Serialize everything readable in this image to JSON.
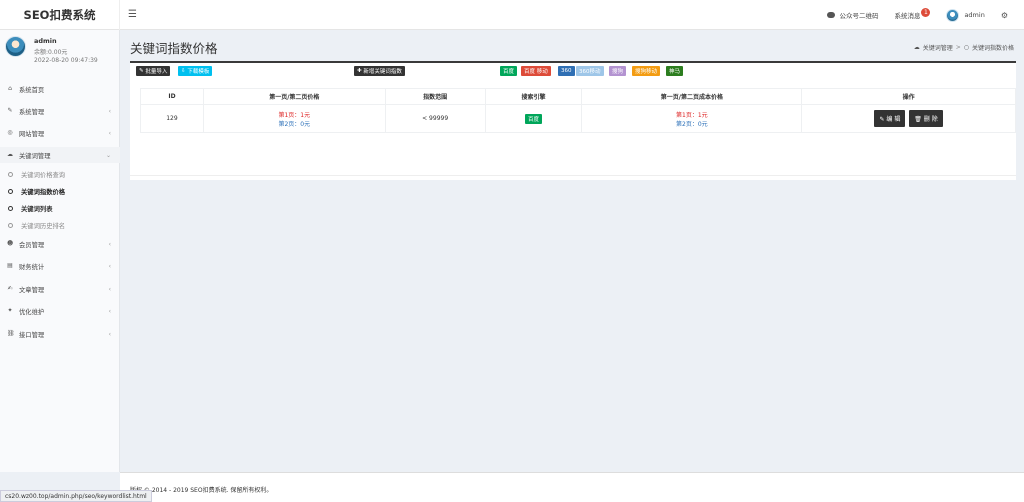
{
  "app": {
    "logo": "SEO扣费系统"
  },
  "topbar": {
    "menu_icon": "☰",
    "qrcode_label": "公众号二维码",
    "messages_label": "系统消息",
    "messages_count": "1",
    "user_name": "admin"
  },
  "user": {
    "name": "admin",
    "balance": "余额:0.00元",
    "login_time": "2022-08-20 09:47:39"
  },
  "sidebar": {
    "items": [
      {
        "label": "系统首页",
        "icon": "home-icon"
      },
      {
        "label": "系统管理",
        "icon": "wrench-icon"
      },
      {
        "label": "网站管理",
        "icon": "globe-icon"
      },
      {
        "label": "关键词管理",
        "icon": "cloud-icon"
      },
      {
        "label": "会员管理",
        "icon": "users-icon"
      },
      {
        "label": "财务统计",
        "icon": "money-icon"
      },
      {
        "label": "文章管理",
        "icon": "edit-icon"
      },
      {
        "label": "优化维护",
        "icon": "tools-icon"
      },
      {
        "label": "接口管理",
        "icon": "link-icon"
      }
    ],
    "sub_items": [
      {
        "label": "关键词价格查询"
      },
      {
        "label": "关键词指数价格"
      },
      {
        "label": "关键词列表"
      },
      {
        "label": "关键词历史排名"
      }
    ]
  },
  "page": {
    "title": "关键词指数价格",
    "breadcrumb": [
      "关键词管理",
      "关键词指数价格"
    ]
  },
  "toolbar": {
    "import_label": "批量导入",
    "download_label": "下载模板",
    "add_label": "新增关键词指数",
    "engines": [
      "百度",
      "百度 移动",
      "360",
      "360移动",
      "搜狗",
      "搜狗移动",
      "神马"
    ]
  },
  "table": {
    "headers": [
      "ID",
      "第一页/第二页价格",
      "指数范围",
      "搜索引擎",
      "第一页/第二页成本价格",
      "操作"
    ],
    "rows": [
      {
        "id": "129",
        "price_page1": "第1页：1元",
        "price_page2": "第2页：0元",
        "index_range": "< 99999",
        "engine": "百度",
        "cost_page1": "第1页：1元",
        "cost_page2": "第2页：0元",
        "edit_label": "编 辑",
        "delete_label": "删 除"
      }
    ]
  },
  "footer": {
    "text": "版权 © 2014 - 2019 SEO扣费系统. 保留所有权利。",
    "status_url": "cs20.wz00.top/admin.php/seo/keywordlist.html"
  }
}
